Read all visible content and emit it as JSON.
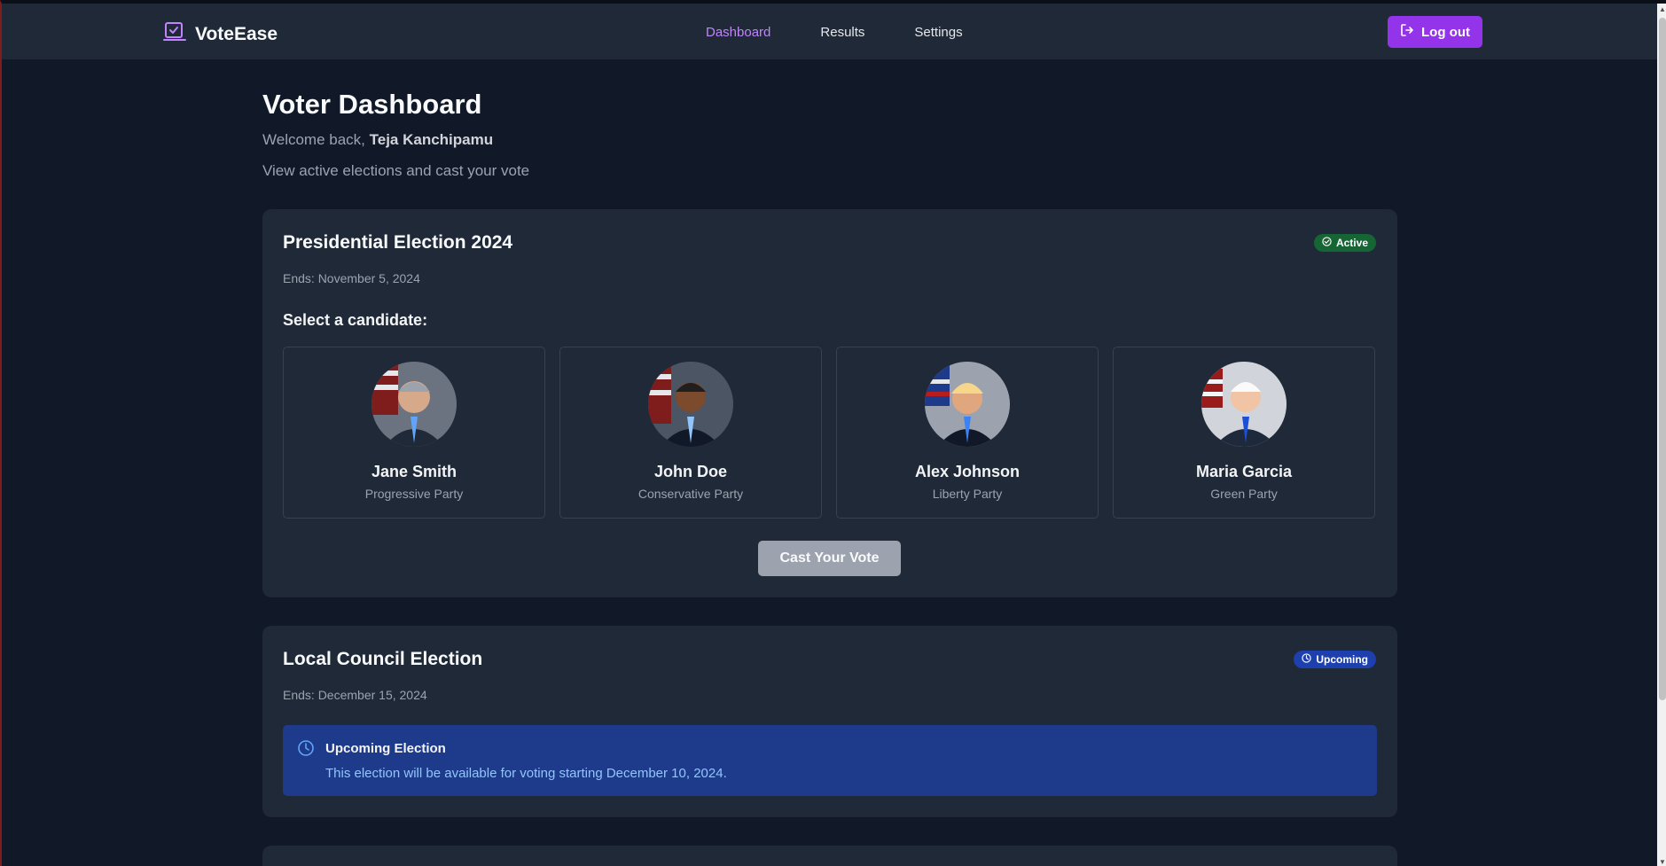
{
  "brand": {
    "name": "VoteEase"
  },
  "nav": {
    "links": [
      {
        "label": "Dashboard",
        "active": true
      },
      {
        "label": "Results",
        "active": false
      },
      {
        "label": "Settings",
        "active": false
      }
    ],
    "logout_label": "Log out"
  },
  "header": {
    "title": "Voter Dashboard",
    "welcome_prefix": "Welcome back, ",
    "user_name": "Teja Kanchipamu",
    "subtitle": "View active elections and cast your vote"
  },
  "elections": [
    {
      "title": "Presidential Election 2024",
      "ends": "Ends: November 5, 2024",
      "status": "Active",
      "select_label": "Select a candidate:",
      "candidates": [
        {
          "name": "Jane Smith",
          "party": "Progressive Party"
        },
        {
          "name": "John Doe",
          "party": "Conservative Party"
        },
        {
          "name": "Alex Johnson",
          "party": "Liberty Party"
        },
        {
          "name": "Maria Garcia",
          "party": "Green Party"
        }
      ],
      "vote_button": "Cast Your Vote"
    },
    {
      "title": "Local Council Election",
      "ends": "Ends: December 15, 2024",
      "status": "Upcoming",
      "notice_title": "Upcoming Election",
      "notice_text": "This election will be available for voting starting December 10, 2024."
    }
  ],
  "colors": {
    "background": "#111827",
    "card": "#1f2937",
    "accent": "#9333ea",
    "active_badge": "#166534",
    "upcoming_badge": "#1e40af",
    "notice_bg": "#1e3a8a"
  }
}
